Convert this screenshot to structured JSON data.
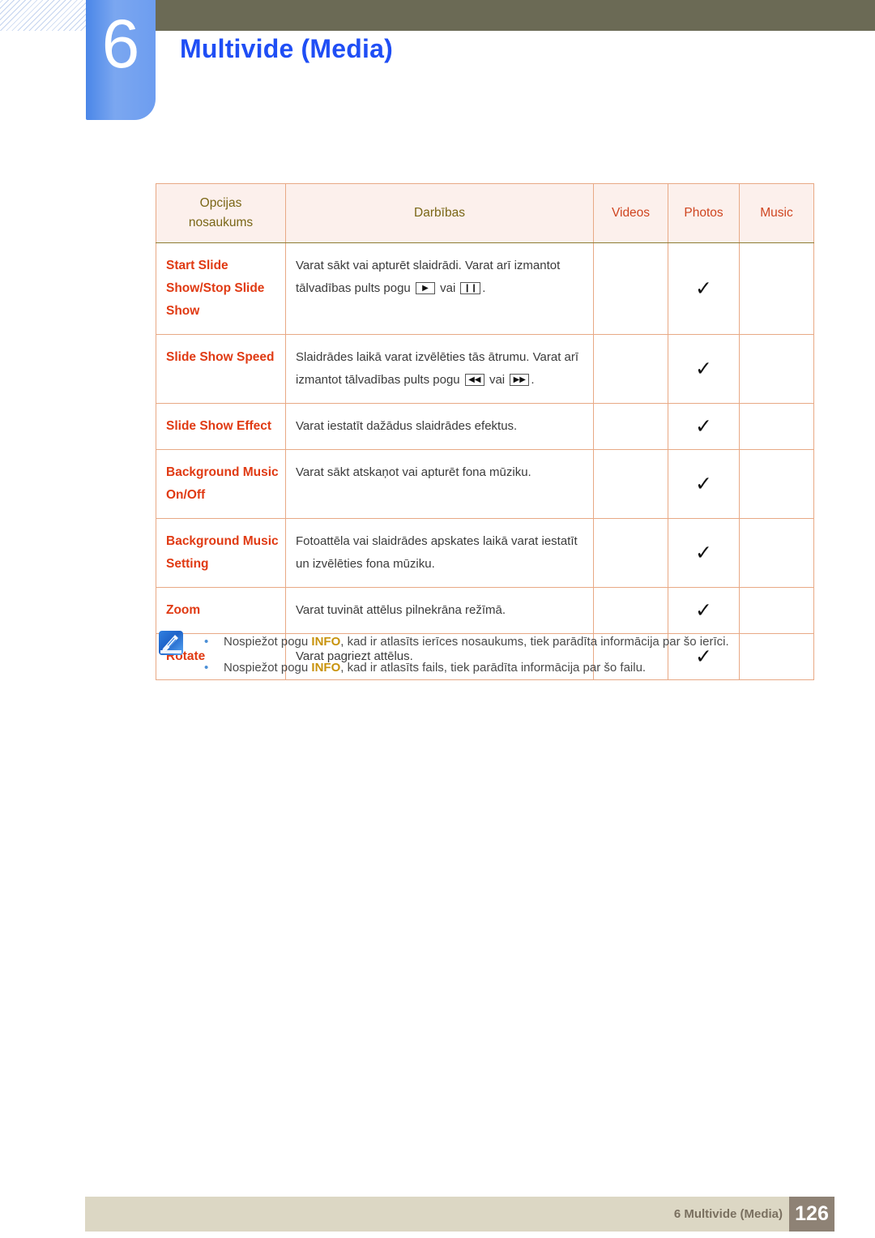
{
  "chapter": {
    "number": "6",
    "title": "Multivide (Media)"
  },
  "table": {
    "headers": {
      "option_name": "Opcijas\nnosaukums",
      "option_name_line1": "Opcijas",
      "option_name_line2": "nosaukums",
      "action": "Darbības",
      "videos": "Videos",
      "photos": "Photos",
      "music": "Music"
    },
    "rows": [
      {
        "option": "Start Slide Show/Stop Slide Show",
        "description_parts": [
          {
            "type": "text",
            "value": "Varat sākt vai apturēt slaidrādi. Varat arī izmantot tālvadības pults pogu "
          },
          {
            "type": "key",
            "value": "▶",
            "name": "play-key"
          },
          {
            "type": "text",
            "value": " vai "
          },
          {
            "type": "key",
            "value": "❙❙",
            "name": "pause-key"
          },
          {
            "type": "text",
            "value": "."
          }
        ],
        "videos": "",
        "photos": "✓",
        "music": ""
      },
      {
        "option": "Slide Show Speed",
        "description_parts": [
          {
            "type": "text",
            "value": "Slaidrādes laikā varat izvēlēties tās ātrumu. Varat arī izmantot tālvadības pults pogu "
          },
          {
            "type": "key",
            "value": "◀◀",
            "name": "rewind-key"
          },
          {
            "type": "text",
            "value": " vai "
          },
          {
            "type": "key",
            "value": "▶▶",
            "name": "fast-forward-key"
          },
          {
            "type": "text",
            "value": "."
          }
        ],
        "videos": "",
        "photos": "✓",
        "music": ""
      },
      {
        "option": "Slide Show Effect",
        "description_parts": [
          {
            "type": "text",
            "value": "Varat iestatīt dažādus slaidrādes efektus."
          }
        ],
        "videos": "",
        "photos": "✓",
        "music": ""
      },
      {
        "option": "Background Music On/Off",
        "description_parts": [
          {
            "type": "text",
            "value": "Varat sākt atskaņot vai apturēt fona mūziku."
          }
        ],
        "videos": "",
        "photos": "✓",
        "music": ""
      },
      {
        "option": "Background Music Setting",
        "description_parts": [
          {
            "type": "text",
            "value": "Fotoattēla vai slaidrādes apskates laikā varat iestatīt un izvēlēties fona mūziku."
          }
        ],
        "videos": "",
        "photos": "✓",
        "music": ""
      },
      {
        "option": "Zoom",
        "description_parts": [
          {
            "type": "text",
            "value": "Varat tuvināt attēlus pilnekrāna režīmā."
          }
        ],
        "videos": "",
        "photos": "✓",
        "music": ""
      },
      {
        "option": "Rotate",
        "description_parts": [
          {
            "type": "text",
            "value": "Varat pagriezt attēlus."
          }
        ],
        "videos": "",
        "photos": "✓",
        "music": ""
      }
    ]
  },
  "note": {
    "icon": "note-pen-icon",
    "bullet": "•",
    "items": [
      [
        {
          "type": "text",
          "value": "Nospiežot pogu "
        },
        {
          "type": "keyword",
          "value": "INFO"
        },
        {
          "type": "text",
          "value": ", kad ir atlasīts ierīces nosaukums, tiek parādīta informācija par šo ierīci."
        }
      ],
      [
        {
          "type": "text",
          "value": "Nospiežot pogu "
        },
        {
          "type": "keyword",
          "value": "INFO"
        },
        {
          "type": "text",
          "value": ", kad ir atlasīts fails, tiek parādīta informācija par šo failu."
        }
      ]
    ]
  },
  "footer": {
    "label": "6 Multivide (Media)",
    "page": "126"
  },
  "colors": {
    "header_bar": "#6b6a55",
    "chapter_blue": "#6d9df0",
    "title_blue": "#1f4ef5",
    "table_outer_border": "#8d7c33",
    "table_inner_border": "#e8a985",
    "table_header_bg": "#fcf0ec",
    "header_text_olive": "#7a6616",
    "header_text_red": "#cf4520",
    "option_text": "#e03a13",
    "body_text": "#3b3b3b",
    "info_keyword": "#c8930c",
    "footer_bar": "#dcd7c4",
    "footer_page_box": "#8e8275"
  }
}
